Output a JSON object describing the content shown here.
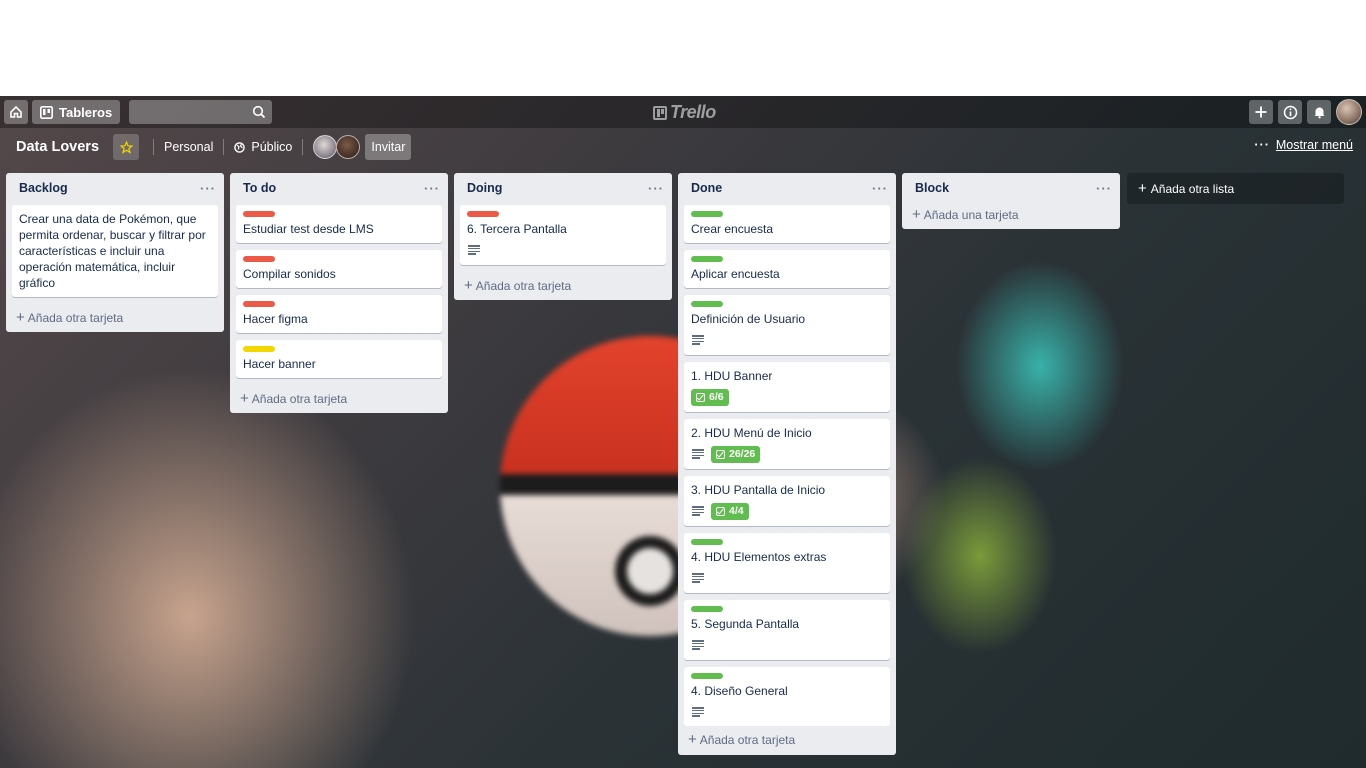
{
  "topbar": {
    "boards_label": "Tableros",
    "search_placeholder": "",
    "logo_text": "Trello"
  },
  "board": {
    "title": "Data Lovers",
    "team": "Personal",
    "visibility": "Público",
    "invite_label": "Invitar",
    "menu_label": "Mostrar menú"
  },
  "lists": [
    {
      "name": "Backlog",
      "cards": [
        {
          "title": "Crear una data de Pokémon, que permita ordenar, buscar y filtrar por características e incluir una operación matemática, incluir gráfico",
          "label": "",
          "desc": false,
          "checklist": ""
        }
      ],
      "add_label": "Añada otra tarjeta"
    },
    {
      "name": "To do",
      "cards": [
        {
          "title": "Estudiar test desde LMS",
          "label": "#eb5a46",
          "desc": false,
          "checklist": ""
        },
        {
          "title": "Compilar sonidos",
          "label": "#eb5a46",
          "desc": false,
          "checklist": ""
        },
        {
          "title": "Hacer figma",
          "label": "#eb5a46",
          "desc": false,
          "checklist": ""
        },
        {
          "title": "Hacer banner",
          "label": "#f2d600",
          "desc": false,
          "checklist": ""
        }
      ],
      "add_label": "Añada otra tarjeta"
    },
    {
      "name": "Doing",
      "cards": [
        {
          "title": "6. Tercera Pantalla",
          "label": "#eb5a46",
          "desc": true,
          "checklist": ""
        }
      ],
      "add_label": "Añada otra tarjeta"
    },
    {
      "name": "Done",
      "cards": [
        {
          "title": "Crear encuesta",
          "label": "#61bd4f",
          "desc": false,
          "checklist": ""
        },
        {
          "title": "Aplicar encuesta",
          "label": "#61bd4f",
          "desc": false,
          "checklist": ""
        },
        {
          "title": "Definición de Usuario",
          "label": "#61bd4f",
          "desc": true,
          "checklist": ""
        },
        {
          "title": "1. HDU Banner",
          "label": "",
          "desc": false,
          "checklist": "6/6"
        },
        {
          "title": "2. HDU Menú de Inicio",
          "label": "",
          "desc": true,
          "checklist": "26/26"
        },
        {
          "title": "3. HDU Pantalla de Inicio",
          "label": "",
          "desc": true,
          "checklist": "4/4"
        },
        {
          "title": "4. HDU Elementos extras",
          "label": "#61bd4f",
          "desc": true,
          "checklist": ""
        },
        {
          "title": "5. Segunda Pantalla",
          "label": "#61bd4f",
          "desc": true,
          "checklist": ""
        },
        {
          "title": "4. Diseño General",
          "label": "#61bd4f",
          "desc": true,
          "checklist": ""
        },
        {
          "title": "",
          "label": "#61bd4f",
          "desc": false,
          "checklist": ""
        }
      ],
      "add_label": "Añada otra tarjeta"
    },
    {
      "name": "Block",
      "cards": [],
      "add_label": "Añada una tarjeta"
    }
  ],
  "add_list_label": "Añada otra lista",
  "icons": {
    "home": "home-icon",
    "boards": "boards-icon",
    "search": "search-icon",
    "plus": "plus-icon",
    "info": "info-icon",
    "bell": "bell-icon",
    "star": "star-icon",
    "globe": "globe-icon",
    "more": "more-icon"
  }
}
